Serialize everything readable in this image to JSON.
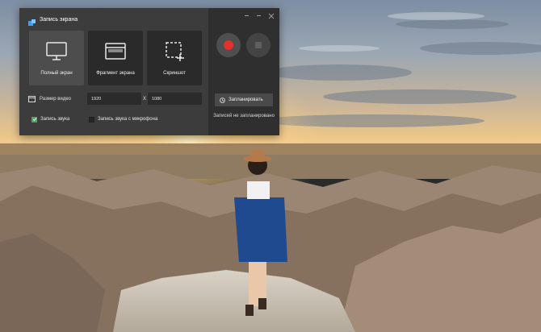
{
  "window": {
    "title": "Запись экрана",
    "controls": {
      "minimize": "–",
      "maximize": "□",
      "close": "×"
    }
  },
  "modes": [
    {
      "label": "Полный экран",
      "icon": "monitor-icon",
      "active": true
    },
    {
      "label": "Фрагмент экрана",
      "icon": "window-fragment-icon",
      "active": false
    },
    {
      "label": "Скриншот",
      "icon": "screenshot-crop-icon",
      "active": false
    }
  ],
  "video_size": {
    "label": "Размер видео",
    "width": "1920",
    "separator": "X",
    "height": "1080"
  },
  "audio": {
    "system_label": "Запись звука",
    "system_checked": true,
    "mic_label": "Запись звука с микрофона",
    "mic_checked": false
  },
  "controls": {
    "record_icon": "record-icon",
    "stop_icon": "stop-icon",
    "schedule_label": "Запланировать",
    "schedule_icon": "clock-icon",
    "schedule_status": "Записей не запланировано"
  },
  "colors": {
    "accent_record": "#e5302e",
    "checkbox_on": "#4aa563",
    "panel_bg": "#3c3c3c",
    "tile_bg": "#2a2a2a",
    "tile_active_bg": "#4d4d4d"
  }
}
